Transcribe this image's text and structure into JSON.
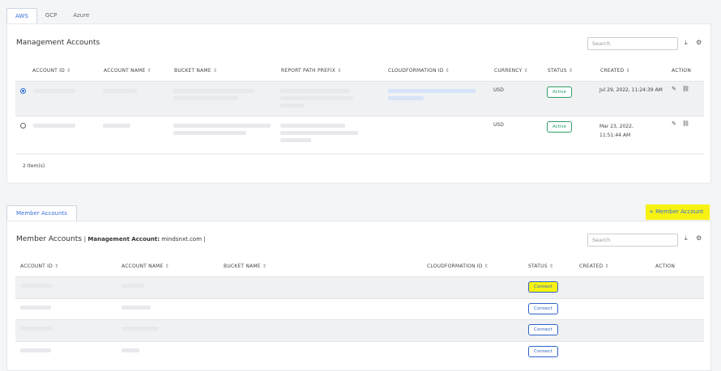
{
  "cloud_tabs": [
    "AWS",
    "GCP",
    "Azure"
  ],
  "management": {
    "title": "Management Accounts",
    "search_placeholder": "Search",
    "columns": [
      "ACCOUNT ID",
      "ACCOUNT NAME",
      "BUCKET NAME",
      "REPORT PATH PREFIX",
      "CLOUDFORMATION ID",
      "CURRENCY",
      "STATUS",
      "CREATED",
      "ACTION"
    ],
    "rows": [
      {
        "currency": "USD",
        "status": "Active",
        "created": "Jul 29, 2022, 11:24:39 AM",
        "selected": true
      },
      {
        "currency": "USD",
        "status": "Active",
        "created": "Mar 23, 2022, 11:51:44 AM",
        "selected": false
      }
    ],
    "count": "2 Item(s)"
  },
  "member": {
    "tab": "Member Accounts",
    "add_button": "+ Member Account",
    "title": "Member Accounts",
    "mgmt_label": "Management Account:",
    "mgmt_value": "mindsnxt.com",
    "search_placeholder": "Search",
    "columns": [
      "ACCOUNT ID",
      "ACCOUNT NAME",
      "BUCKET NAME",
      "CLOUDFORMATION ID",
      "STATUS",
      "CREATED",
      "ACTION"
    ],
    "rows": [
      {
        "status": "Connect"
      },
      {
        "status": "Connect"
      },
      {
        "status": "Connect"
      },
      {
        "status": "Connect"
      }
    ]
  },
  "icons": {
    "download": "download-icon",
    "settings": "gear-icon",
    "edit": "pencil-icon",
    "link": "link-icon"
  }
}
